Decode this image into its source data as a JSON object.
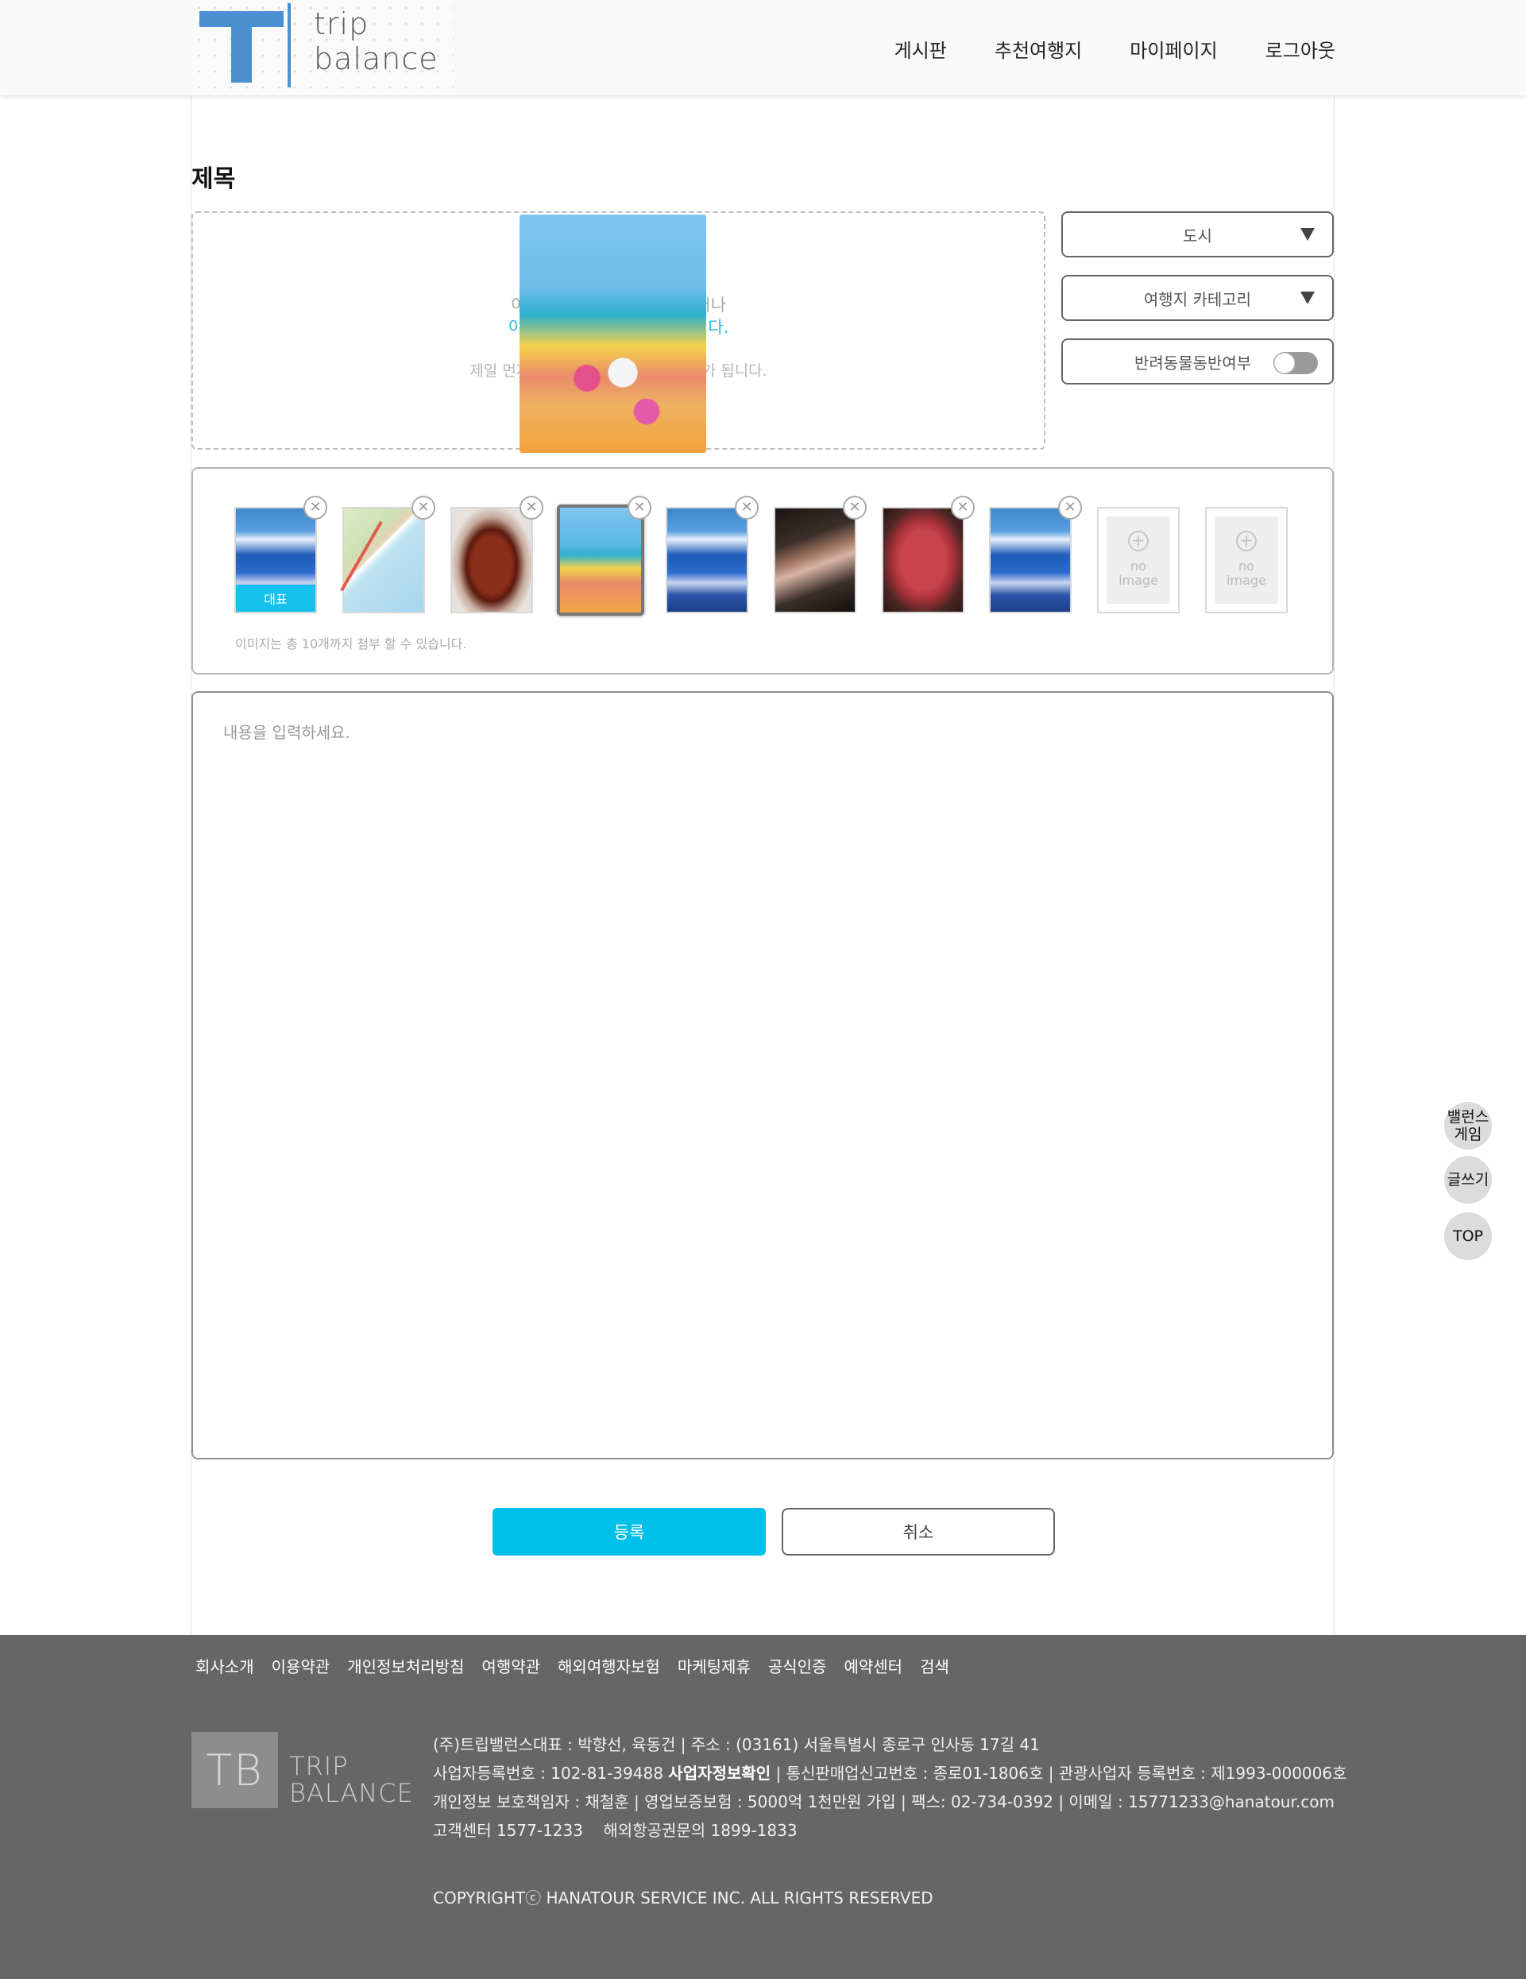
{
  "header": {
    "logo_word_line1": "trip",
    "logo_word_line2": "balance",
    "nav": [
      "게시판",
      "추천여행지",
      "마이페이지",
      "로그아웃"
    ]
  },
  "page_title": "제목",
  "dropzone": {
    "line1": "이미지를 여기로 끌어다 놓거나",
    "line2": "이곳을 클릭하면 업로드 됩니다.",
    "line3": "제일 먼저 올린 이미지가 대표 이미지가 됩니다."
  },
  "controls": {
    "city_label": "도시",
    "category_label": "여행지 카테고리",
    "pet_label": "반려동물동반여부",
    "pet_toggle_on": false
  },
  "images": {
    "items": [
      {
        "kind": "coast",
        "representative": true
      },
      {
        "kind": "map",
        "representative": false
      },
      {
        "kind": "chicken",
        "representative": false
      },
      {
        "kind": "beach",
        "representative": false,
        "active": true
      },
      {
        "kind": "coast",
        "representative": false
      },
      {
        "kind": "meat-dark",
        "representative": false
      },
      {
        "kind": "meat-red",
        "representative": false
      },
      {
        "kind": "coast",
        "representative": false
      }
    ],
    "representative_label": "대표",
    "empty_slots": 2,
    "no_image_label_line1": "no",
    "no_image_label_line2": "image",
    "note": "이미지는 총 10개까지 첨부 할 수 있습니다."
  },
  "content": {
    "placeholder": "내용을 입력하세요."
  },
  "buttons": {
    "submit": "등록",
    "cancel": "취소"
  },
  "floating": {
    "balance_game_line1": "밸런스",
    "balance_game_line2": "게임",
    "write": "글쓰기",
    "top": "TOP"
  },
  "footer": {
    "links": [
      "회사소개",
      "이용약관",
      "개인정보처리방침",
      "여행약관",
      "해외여행자보험",
      "마케팅제휴",
      "공식인증",
      "예약센터",
      "검색"
    ],
    "logo_abbr": "TB",
    "logo_word_line1": "TRIP",
    "logo_word_line2": "BALANCE",
    "info_line1": "(주)트립밸런스대표 : 박향선, 육동건 | 주소 : (03161) 서울특별시 종로구 인사동 17길 41",
    "info_line2_a": "사업자등록번호 : 102-81-39488 ",
    "info_line2_link": "사업자정보확인",
    "info_line2_b": " | 통신판매업신고번호 : 종로01-1806호 | 관광사업자 등록번호 : 제1993-000006호",
    "info_line3": "개인정보 보호책임자 : 채철훈 | 영업보증보험 : 5000억 1천만원 가입 | 팩스: 02-734-0392 | 이메일 : 15771233@hanatour.com",
    "info_line4": "고객센터 1577-1233    해외항공권문의 1899-1833",
    "copyright": "COPYRIGHTⓒ HANATOUR SERVICE INC. ALL RIGHTS RESERVED"
  }
}
